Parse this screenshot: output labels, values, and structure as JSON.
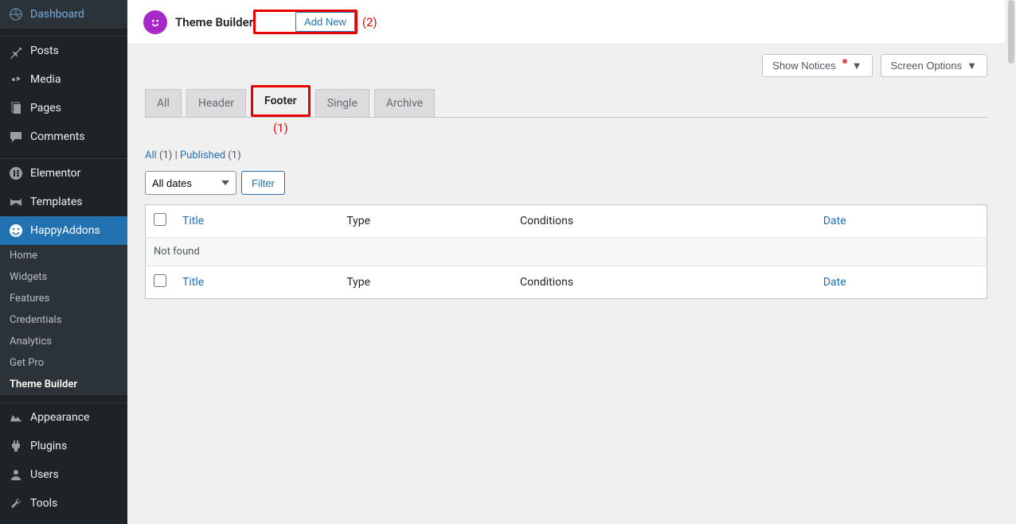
{
  "sidebar": {
    "items": [
      {
        "label": "Dashboard",
        "icon": "dashboard"
      },
      {
        "label": "Posts",
        "icon": "pin"
      },
      {
        "label": "Media",
        "icon": "media"
      },
      {
        "label": "Pages",
        "icon": "pages"
      },
      {
        "label": "Comments",
        "icon": "comments"
      },
      {
        "label": "Elementor",
        "icon": "elementor"
      },
      {
        "label": "Templates",
        "icon": "templates"
      },
      {
        "label": "HappyAddons",
        "icon": "happy",
        "active": true
      },
      {
        "label": "Appearance",
        "icon": "appearance"
      },
      {
        "label": "Plugins",
        "icon": "plugins"
      },
      {
        "label": "Users",
        "icon": "users"
      },
      {
        "label": "Tools",
        "icon": "tools"
      }
    ],
    "submenu": [
      {
        "label": "Home"
      },
      {
        "label": "Widgets"
      },
      {
        "label": "Features"
      },
      {
        "label": "Credentials"
      },
      {
        "label": "Analytics"
      },
      {
        "label": "Get Pro"
      },
      {
        "label": "Theme Builder",
        "active": true
      }
    ]
  },
  "header": {
    "title": "Theme Builder",
    "add_new": "Add New",
    "annotation_2": "(2)"
  },
  "top_actions": {
    "show_notices": "Show Notices",
    "screen_options": "Screen Options"
  },
  "tabs": [
    {
      "label": "All"
    },
    {
      "label": "Header"
    },
    {
      "label": "Footer",
      "active": true,
      "annotation": "(1)"
    },
    {
      "label": "Single"
    },
    {
      "label": "Archive"
    }
  ],
  "subsub": {
    "all_label": "All",
    "all_count": "(1)",
    "separator": " | ",
    "published_label": "Published",
    "published_count": "(1)"
  },
  "filters": {
    "all_dates": "All dates",
    "filter_btn": "Filter"
  },
  "table": {
    "headers": {
      "title": "Title",
      "type": "Type",
      "conditions": "Conditions",
      "date": "Date"
    },
    "not_found": "Not found"
  }
}
